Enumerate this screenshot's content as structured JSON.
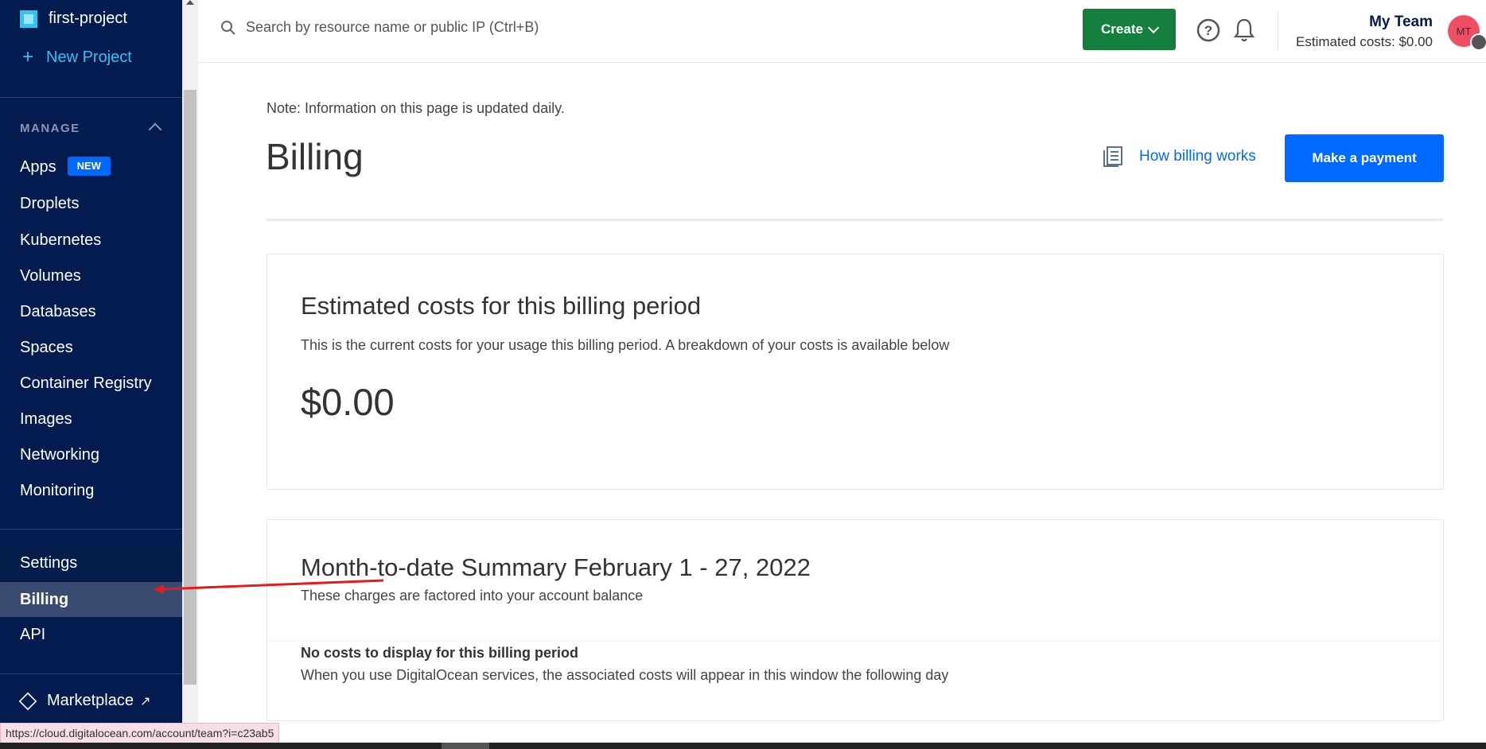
{
  "sidebar": {
    "project_name": "first-project",
    "new_project_label": "New Project",
    "section_title": "MANAGE",
    "items": [
      {
        "label": "Apps",
        "badge": "NEW"
      },
      {
        "label": "Droplets"
      },
      {
        "label": "Kubernetes"
      },
      {
        "label": "Volumes"
      },
      {
        "label": "Databases"
      },
      {
        "label": "Spaces"
      },
      {
        "label": "Container Registry"
      },
      {
        "label": "Images"
      },
      {
        "label": "Networking"
      },
      {
        "label": "Monitoring"
      }
    ],
    "account_items": [
      {
        "label": "Settings"
      },
      {
        "label": "Billing"
      },
      {
        "label": "API"
      }
    ],
    "marketplace_label": "Marketplace"
  },
  "header": {
    "search_placeholder": "Search by resource name or public IP (Ctrl+B)",
    "create_label": "Create",
    "team_name": "My Team",
    "estimated_costs": "Estimated costs: $0.00",
    "avatar_initials": "MT"
  },
  "main": {
    "note": "Note: Information on this page is updated daily.",
    "title": "Billing",
    "how_billing_works": "How billing works",
    "make_payment": "Make a payment",
    "estimated_card": {
      "title": "Estimated costs for this billing period",
      "description": "This is the current costs for your usage this billing period. A breakdown of your costs is available below",
      "amount": "$0.00"
    },
    "summary_card": {
      "title": "Month-to-date Summary February 1 - 27, 2022",
      "description": "These charges are factored into your account balance",
      "no_costs_title": "No costs to display for this billing period",
      "no_costs_desc": "When you use DigitalOcean services, the associated costs will appear in this window the following day"
    }
  },
  "status_bar": {
    "url": "https://cloud.digitalocean.com/account/team?i=c23ab5"
  },
  "colors": {
    "sidebar_bg": "#031b4e",
    "accent_blue": "#0069ff",
    "create_green": "#15803d",
    "annotation_red": "#e21b1b"
  }
}
